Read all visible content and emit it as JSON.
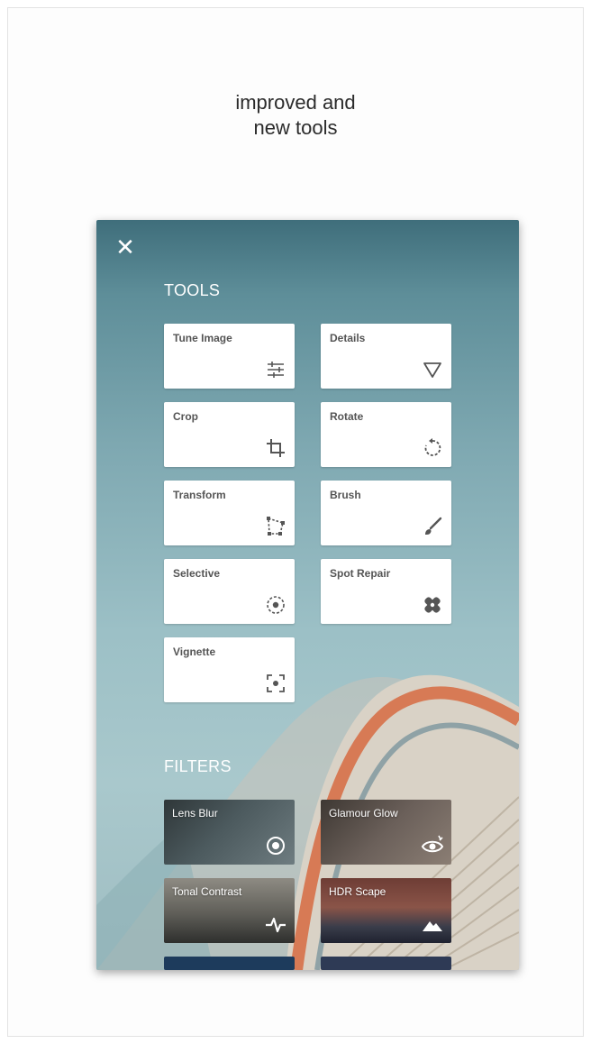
{
  "headline": {
    "line1": "improved and",
    "line2": "new tools"
  },
  "panel": {
    "close_glyph": "✕",
    "tools_title": "TOOLS",
    "filters_title": "FILTERS"
  },
  "tools": [
    {
      "label": "Tune Image",
      "icon": "sliders-icon"
    },
    {
      "label": "Details",
      "icon": "triangle-icon"
    },
    {
      "label": "Crop",
      "icon": "crop-icon"
    },
    {
      "label": "Rotate",
      "icon": "rotate-icon"
    },
    {
      "label": "Transform",
      "icon": "transform-icon"
    },
    {
      "label": "Brush",
      "icon": "brush-icon"
    },
    {
      "label": "Selective",
      "icon": "selective-icon"
    },
    {
      "label": "Spot Repair",
      "icon": "bandage-icon"
    },
    {
      "label": "Vignette",
      "icon": "vignette-icon"
    }
  ],
  "filters": [
    {
      "label": "Lens Blur",
      "icon": "lens-blur-icon"
    },
    {
      "label": "Glamour Glow",
      "icon": "eye-sparkle-icon"
    },
    {
      "label": "Tonal Contrast",
      "icon": "pulse-icon"
    },
    {
      "label": "HDR Scape",
      "icon": "mountains-icon"
    }
  ],
  "colors": {
    "background_top": "#3f6e7b",
    "background_bottom": "#a9c8cc",
    "card_bg": "#ffffff",
    "icon_color": "#555555"
  }
}
